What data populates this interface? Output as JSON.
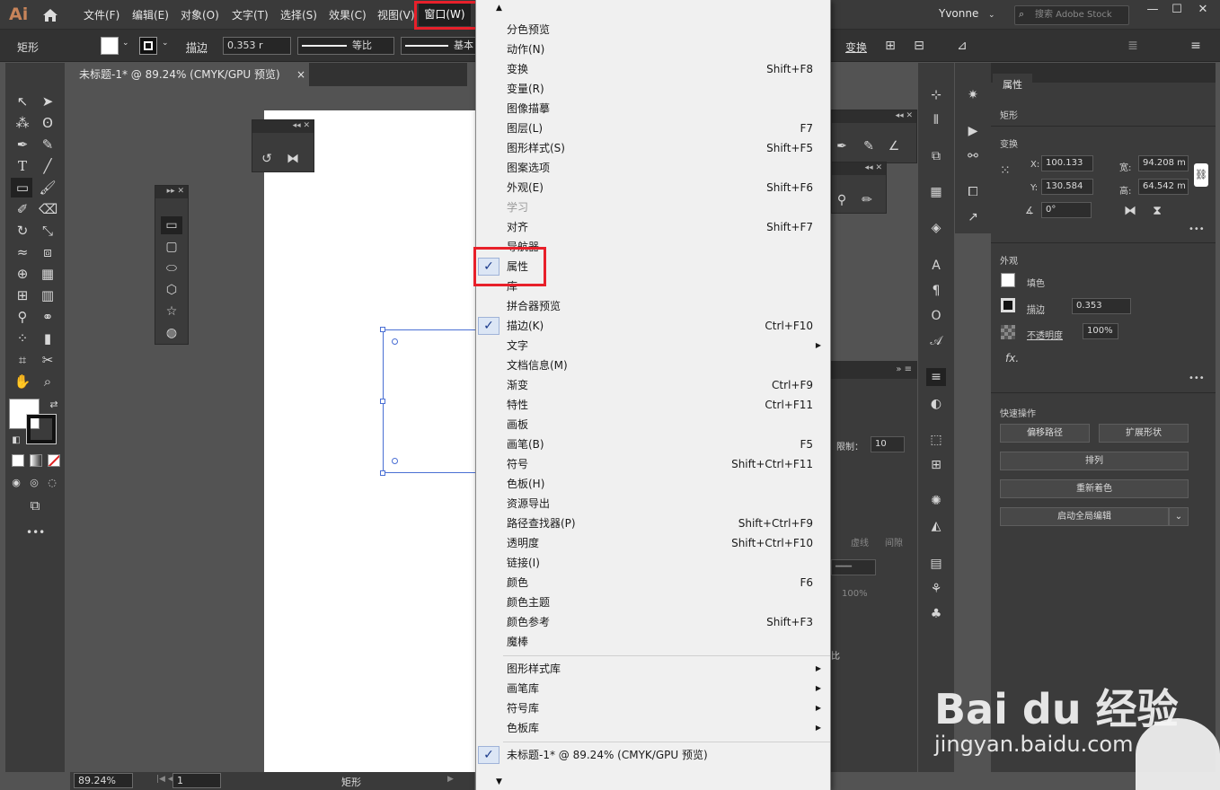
{
  "app": {
    "logo": "Ai",
    "user": "Yvonne",
    "search_placeholder": "搜索 Adobe Stock"
  },
  "menubar": {
    "items": [
      "文件(F)",
      "编辑(E)",
      "对象(O)",
      "文字(T)",
      "选择(S)",
      "效果(C)",
      "视图(V)",
      "窗口(W)"
    ]
  },
  "window_controls": [
    "—",
    "☐",
    "✕"
  ],
  "control_bar": {
    "object_type": "矩形",
    "stroke_label": "描边",
    "stroke_value": "0.353",
    "stroke_unit": "r",
    "profile": "等比",
    "brush": "基本",
    "transform": "变换"
  },
  "document": {
    "tab_title": "未标题-1* @ 89.24% (CMYK/GPU 预览)",
    "close": "×",
    "zoom": "89.24%",
    "artboard_num": "1",
    "status_label": "矩形"
  },
  "window_menu": {
    "items": [
      {
        "label": "分色预览",
        "shortcut": ""
      },
      {
        "label": "动作(N)",
        "shortcut": ""
      },
      {
        "label": "变换",
        "shortcut": "Shift+F8"
      },
      {
        "label": "变量(R)",
        "shortcut": ""
      },
      {
        "label": "图像描摹",
        "shortcut": ""
      },
      {
        "label": "图层(L)",
        "shortcut": "F7"
      },
      {
        "label": "图形样式(S)",
        "shortcut": "Shift+F5"
      },
      {
        "label": "图案选项",
        "shortcut": ""
      },
      {
        "label": "外观(E)",
        "shortcut": "Shift+F6"
      },
      {
        "label": "学习",
        "shortcut": "",
        "disabled": true
      },
      {
        "label": "对齐",
        "shortcut": "Shift+F7"
      },
      {
        "label": "导航器",
        "shortcut": ""
      },
      {
        "label": "属性",
        "shortcut": "",
        "checked": true
      },
      {
        "label": "库",
        "shortcut": ""
      },
      {
        "label": "拼合器预览",
        "shortcut": ""
      },
      {
        "label": "描边(K)",
        "shortcut": "Ctrl+F10",
        "checked": true
      },
      {
        "label": "文字",
        "shortcut": "",
        "submenu": true
      },
      {
        "label": "文档信息(M)",
        "shortcut": ""
      },
      {
        "label": "渐变",
        "shortcut": "Ctrl+F9"
      },
      {
        "label": "特性",
        "shortcut": "Ctrl+F11"
      },
      {
        "label": "画板",
        "shortcut": ""
      },
      {
        "label": "画笔(B)",
        "shortcut": "F5"
      },
      {
        "label": "符号",
        "shortcut": "Shift+Ctrl+F11"
      },
      {
        "label": "色板(H)",
        "shortcut": ""
      },
      {
        "label": "资源导出",
        "shortcut": ""
      },
      {
        "label": "路径查找器(P)",
        "shortcut": "Shift+Ctrl+F9"
      },
      {
        "label": "透明度",
        "shortcut": "Shift+Ctrl+F10"
      },
      {
        "label": "链接(I)",
        "shortcut": ""
      },
      {
        "label": "颜色",
        "shortcut": "F6"
      },
      {
        "label": "颜色主题",
        "shortcut": ""
      },
      {
        "label": "颜色参考",
        "shortcut": "Shift+F3"
      },
      {
        "label": "魔棒",
        "shortcut": ""
      }
    ],
    "libraries": [
      {
        "label": "图形样式库"
      },
      {
        "label": "画笔库"
      },
      {
        "label": "符号库"
      },
      {
        "label": "色板库"
      }
    ],
    "open_docs": [
      {
        "label": "未标题-1* @ 89.24% (CMYK/GPU 预览)",
        "checked": true
      }
    ],
    "check_glyph": "✓",
    "submenu_glyph": "▶",
    "scroll_up": "▲",
    "scroll_down": "▼"
  },
  "properties_panel": {
    "tab": "属性",
    "object": "矩形",
    "transform_title": "变换",
    "x_label": "X:",
    "x_value": "100.133",
    "y_label": "Y:",
    "y_value": "130.584",
    "w_label": "宽:",
    "w_value": "94.208 m",
    "h_label": "高:",
    "h_value": "64.542 m",
    "angle_value": "0°",
    "appearance_title": "外观",
    "fill_label": "填色",
    "stroke_label": "描边",
    "stroke_value": "0.353",
    "opacity_label": "不透明度",
    "opacity_value": "100%",
    "fx": "fx.",
    "more": "•••",
    "quick_actions_title": "快速操作",
    "btn_offset": "偏移路径",
    "btn_expand": "扩展形状",
    "btn_arrange": "排列",
    "btn_recolor": "重新着色",
    "btn_global_edit": "启动全局编辑"
  },
  "partial_panel": {
    "limit_label": "限制：",
    "limit_value": "10",
    "labels": [
      "虚线",
      "间隙"
    ],
    "ratio_label": "比",
    "opacity_value": "100%"
  },
  "watermark": {
    "logo": "Bai du 经验",
    "url": "jingyan.baidu.com"
  },
  "colors": {
    "highlight_red": "#e8202a",
    "menu_bg": "#f0f0f0",
    "panel_bg": "#3b3b3b",
    "canvas_bg": "#535353",
    "selection_blue": "#4a6fd4"
  }
}
